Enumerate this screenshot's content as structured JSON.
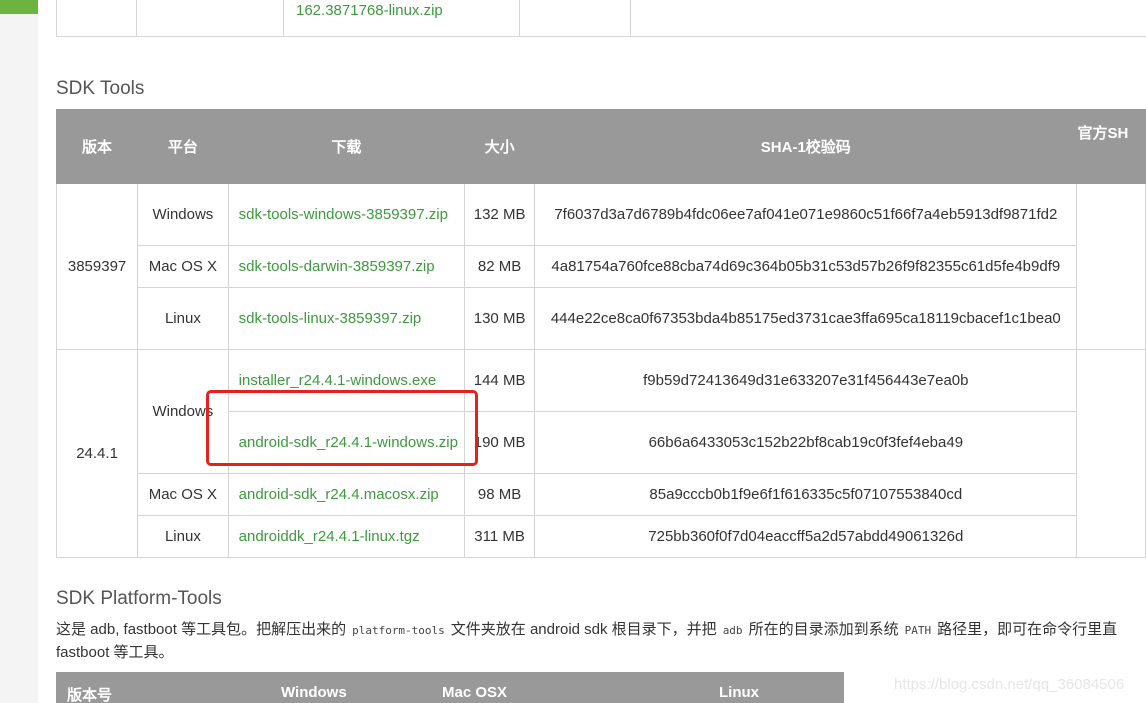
{
  "previous_table": {
    "link_text": "162.3871768-linux.zip"
  },
  "sdk_tools": {
    "heading": "SDK Tools",
    "headers": [
      "版本",
      "平台",
      "下载",
      "大小",
      "SHA-1校验码",
      "官方SH"
    ],
    "group1": {
      "version": "3859397",
      "rows": [
        {
          "platform": "Windows",
          "file": "sdk-tools-windows-3859397.zip",
          "size": "132 MB",
          "sha1": "7f6037d3a7d6789b4fdc06ee7af041e071e9860c51f66f7a4eb5913df9871fd2"
        },
        {
          "platform": "Mac OS X",
          "file": "sdk-tools-darwin-3859397.zip",
          "size": "82 MB",
          "sha1": "4a81754a760fce88cba74d69c364b05b31c53d57b26f9f82355c61d5fe4b9df9"
        },
        {
          "platform": "Linux",
          "file": "sdk-tools-linux-3859397.zip",
          "size": "130 MB",
          "sha1": "444e22ce8ca0f67353bda4b85175ed3731cae3ffa695ca18119cbacef1c1bea0"
        }
      ]
    },
    "group2": {
      "version": "24.4.1",
      "windows_label": "Windows",
      "rows": [
        {
          "file": "installer_r24.4.1-windows.exe",
          "size": "144 MB",
          "sha1": "f9b59d72413649d31e633207e31f456443e7ea0b"
        },
        {
          "file": "android-sdk_r24.4.1-windows.zip",
          "size": "190 MB",
          "sha1": "66b6a6433053c152b22bf8cab19c0f3fef4eba49"
        },
        {
          "platform": "Mac OS X",
          "file": "android-sdk_r24.4.macosx.zip",
          "size": "98 MB",
          "sha1": "85a9cccb0b1f9e6f1f616335c5f07107553840cd"
        },
        {
          "platform": "Linux",
          "file": "androiddk_r24.4.1-linux.tgz",
          "size": "311 MB",
          "sha1": "725bb360f0f7d04eaccff5a2d57abdd49061326d"
        }
      ]
    }
  },
  "platform_tools": {
    "heading": "SDK Platform-Tools",
    "desc_1": "这是 adb, fastboot 等工具包。把解压出来的",
    "code_1": "platform-tools",
    "desc_2": "文件夹放在 android sdk 根目录下，并把",
    "code_2": "adb",
    "desc_3": "所在的目录添加到系统",
    "code_3": "PATH",
    "desc_4": "路径里，即可在命令行里直",
    "desc_line2": "fastboot 等工具。",
    "headers": [
      "版本号",
      "Windows",
      "Mac OSX",
      "Linux"
    ]
  },
  "watermark": "https://blog.csdn.net/qq_36084506",
  "colors": {
    "accent_green": "#6db33f",
    "link_green": "#3d9a3d",
    "header_gray": "#999999",
    "highlight_red": "#e2231a"
  }
}
